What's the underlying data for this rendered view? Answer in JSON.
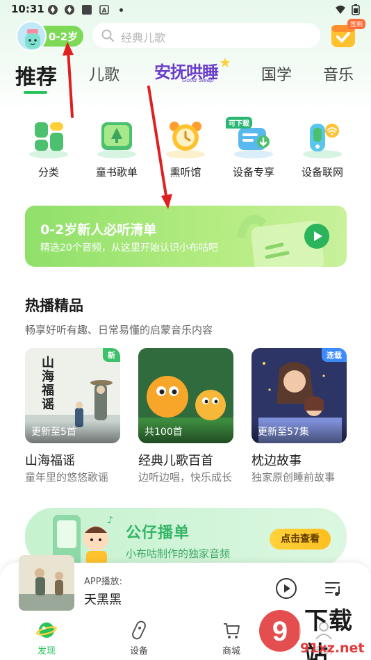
{
  "status_bar": {
    "time": "10:31"
  },
  "header": {
    "age_label": "0-2岁",
    "search_placeholder": "经典儿歌",
    "checkin_badge": "签到"
  },
  "tabs": [
    {
      "label": "推荐"
    },
    {
      "label": "儿歌"
    },
    {
      "label": "安抚哄睡",
      "sub": "Good Sleep"
    },
    {
      "label": "国学"
    },
    {
      "label": "音乐"
    }
  ],
  "quick_items": [
    {
      "label": "分类"
    },
    {
      "label": "童书歌单"
    },
    {
      "label": "熏听馆"
    },
    {
      "label": "设备专享",
      "tag": "可下载"
    },
    {
      "label": "设备联网"
    }
  ],
  "banner": {
    "title": "0-2岁新人必听清单",
    "subtitle": "精选20个音频，从这里开始认识小布咕吧"
  },
  "hot_section": {
    "title": "热播精品",
    "subtitle": "畅享好听有趣、日常易懂的启蒙音乐内容",
    "cards": [
      {
        "title": "山海福谣",
        "desc": "童年里的悠悠歌谣",
        "meta": "更新至5首",
        "badge": "新",
        "cover_text": "山海福谣"
      },
      {
        "title": "经典儿歌百首",
        "desc": "边听边唱，快乐成长",
        "meta": "共100首"
      },
      {
        "title": "枕边故事",
        "desc": "独家原创睡前故事",
        "meta": "更新至57集",
        "badge": "连载"
      }
    ]
  },
  "playlist_banner": {
    "title": "公仔播单",
    "subtitle": "小布咕制作的独家音频",
    "button": "点击查看"
  },
  "player": {
    "source": "APP播放:",
    "title": "天黑黑"
  },
  "bottom_nav": [
    {
      "label": "发现"
    },
    {
      "label": "设备"
    },
    {
      "label": "商城"
    },
    {
      "label": "我的"
    }
  ],
  "watermark": {
    "text": "下载站",
    "url": "91xz.net"
  },
  "colors": {
    "accent": "#27c25a",
    "banner": "#8fe06a",
    "annotation": "#e02020"
  }
}
